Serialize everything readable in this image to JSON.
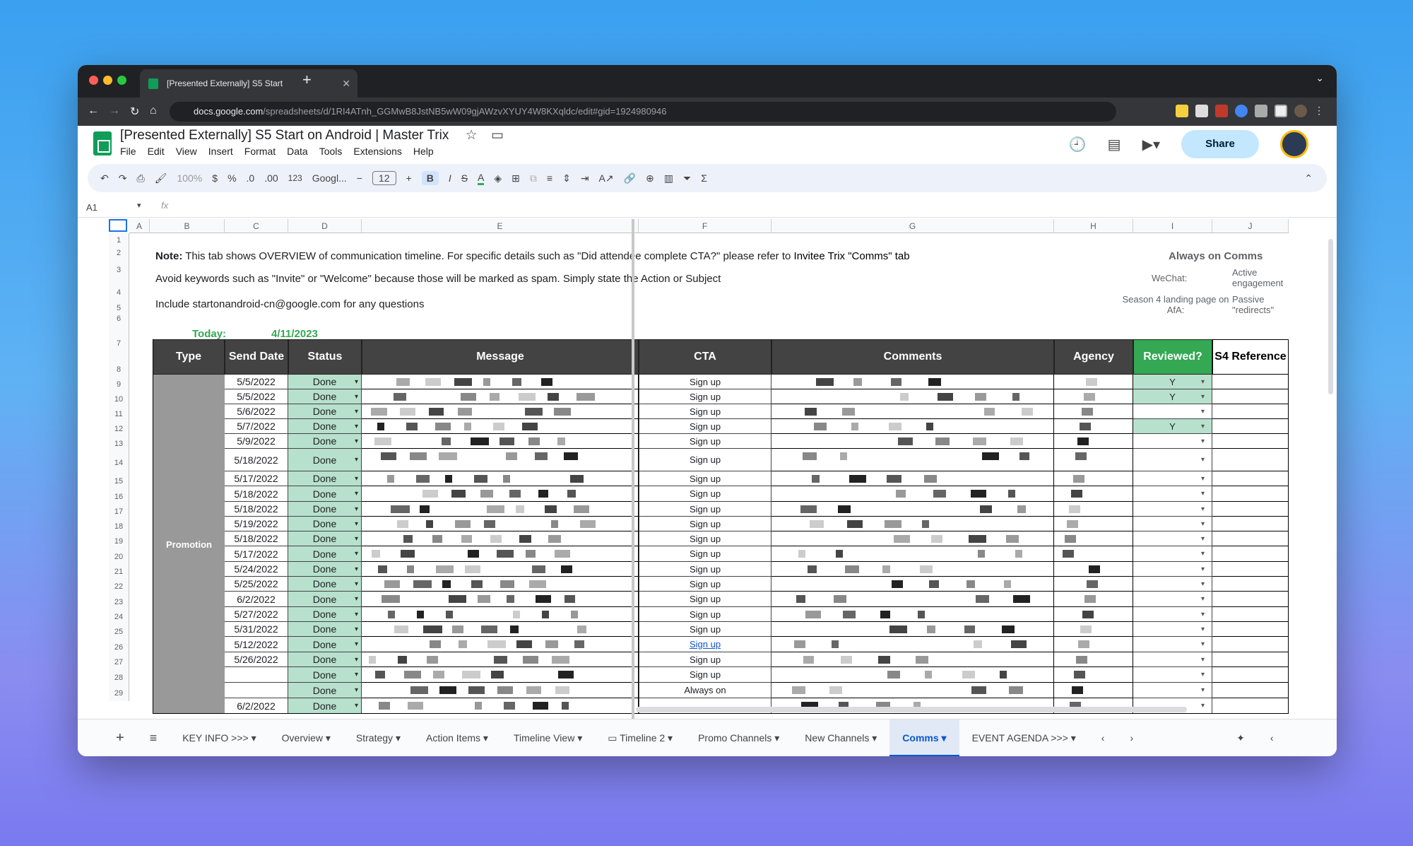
{
  "browser": {
    "tab_title": "[Presented Externally] S5 Start",
    "url_domain": "docs.google.com",
    "url_path": "/spreadsheets/d/1RI4ATnh_GGMwB8JstNB5wW09gjAWzvXYUY4W8KXqldc/edit#gid=1924980946"
  },
  "doc": {
    "title": "[Presented Externally] S5 Start on Android | Master Trix",
    "menus": [
      "File",
      "Edit",
      "View",
      "Insert",
      "Format",
      "Data",
      "Tools",
      "Extensions",
      "Help"
    ],
    "share_label": "Share"
  },
  "toolbar": {
    "zoom": "100%",
    "currency": "$",
    "percent": "%",
    "dec_less": ".0",
    "dec_more": ".00",
    "num_format": "123",
    "font": "Googl...",
    "font_size": "12"
  },
  "formula_bar": {
    "cell_ref": "A1"
  },
  "columns": [
    "A",
    "B",
    "C",
    "D",
    "E",
    "F",
    "G",
    "H",
    "I",
    "J"
  ],
  "notes": {
    "note_label": "Note:",
    "note_text": " This tab shows OVERVIEW of communication timeline. For specific details such as \"Did attendee complete CTA?\" please refer to ",
    "note_link": "Invitee Trix \"Comms\" tab",
    "line2": "Avoid keywords such as \"Invite\" or \"Welcome\" because those will be marked as spam. Simply state the Action or Subject",
    "line3": "Include startonandroid-cn@google.com for any questions",
    "today_label": "Today:",
    "today_value": "4/11/2023"
  },
  "always_on": {
    "title": "Always on Comms",
    "wechat_label": "WeChat:",
    "wechat_value": "Active engagement",
    "landing_label": "Season 4 landing page on AfA:",
    "landing_value": "Passive \"redirects\""
  },
  "table": {
    "headers": {
      "type": "Type",
      "send_date": "Send Date",
      "status": "Status",
      "message": "Message",
      "cta": "CTA",
      "comments": "Comments",
      "agency": "Agency",
      "reviewed": "Reviewed?",
      "s4_ref": "S4 Reference"
    },
    "type_value": "Promotion",
    "rows": [
      {
        "num": "8",
        "date": "5/5/2022",
        "status": "Done",
        "cta": "Sign up",
        "reviewed": "Y"
      },
      {
        "num": "9",
        "date": "5/5/2022",
        "status": "Done",
        "cta": "Sign up",
        "reviewed": "Y"
      },
      {
        "num": "10",
        "date": "5/6/2022",
        "status": "Done",
        "cta": "Sign up",
        "reviewed": ""
      },
      {
        "num": "11",
        "date": "5/7/2022",
        "status": "Done",
        "cta": "Sign up",
        "reviewed": "Y"
      },
      {
        "num": "12",
        "date": "5/9/2022",
        "status": "Done",
        "cta": "Sign up",
        "reviewed": ""
      },
      {
        "num": "13",
        "date": "5/18/2022",
        "status": "Done",
        "cta": "Sign up",
        "reviewed": ""
      },
      {
        "num": "14",
        "date": "5/17/2022",
        "status": "Done",
        "cta": "Sign up",
        "reviewed": ""
      },
      {
        "num": "15",
        "date": "5/18/2022",
        "status": "Done",
        "cta": "Sign up",
        "reviewed": ""
      },
      {
        "num": "16",
        "date": "5/18/2022",
        "status": "Done",
        "cta": "Sign up",
        "reviewed": ""
      },
      {
        "num": "17",
        "date": "5/19/2022",
        "status": "Done",
        "cta": "Sign up",
        "reviewed": ""
      },
      {
        "num": "18",
        "date": "5/18/2022",
        "status": "Done",
        "cta": "Sign up",
        "reviewed": ""
      },
      {
        "num": "19",
        "date": "5/17/2022",
        "status": "Done",
        "cta": "Sign up",
        "reviewed": ""
      },
      {
        "num": "20",
        "date": "5/24/2022",
        "status": "Done",
        "cta": "Sign up",
        "reviewed": ""
      },
      {
        "num": "21",
        "date": "5/25/2022",
        "status": "Done",
        "cta": "Sign up",
        "reviewed": ""
      },
      {
        "num": "22",
        "date": "6/2/2022",
        "status": "Done",
        "cta": "Sign up",
        "reviewed": ""
      },
      {
        "num": "23",
        "date": "5/27/2022",
        "status": "Done",
        "cta": "Sign up",
        "reviewed": ""
      },
      {
        "num": "24",
        "date": "5/31/2022",
        "status": "Done",
        "cta": "Sign up",
        "reviewed": ""
      },
      {
        "num": "25",
        "date": "5/12/2022",
        "status": "Done",
        "cta": "Sign up",
        "reviewed": "",
        "link": true
      },
      {
        "num": "26",
        "date": "5/26/2022",
        "status": "Done",
        "cta": "Sign up",
        "reviewed": ""
      },
      {
        "num": "27",
        "date": "",
        "status": "Done",
        "cta": "Sign up",
        "reviewed": ""
      },
      {
        "num": "28",
        "date": "",
        "status": "Done",
        "cta": "Always on",
        "reviewed": ""
      },
      {
        "num": "29",
        "date": "6/2/2022",
        "status": "Done",
        "cta": "",
        "reviewed": ""
      }
    ]
  },
  "sheet_tabs": [
    "KEY INFO >>>",
    "Overview",
    "Strategy",
    "Action Items",
    "Timeline View",
    "Timeline 2",
    "Promo Channels",
    "New Channels",
    "Comms",
    "EVENT AGENDA >>>"
  ],
  "active_tab": "Comms",
  "colors": {
    "header_bg": "#434343",
    "status_green": "#b7e1cd",
    "reviewed_green": "#34a853",
    "type_gray": "#999999",
    "today_green": "#34a853"
  }
}
